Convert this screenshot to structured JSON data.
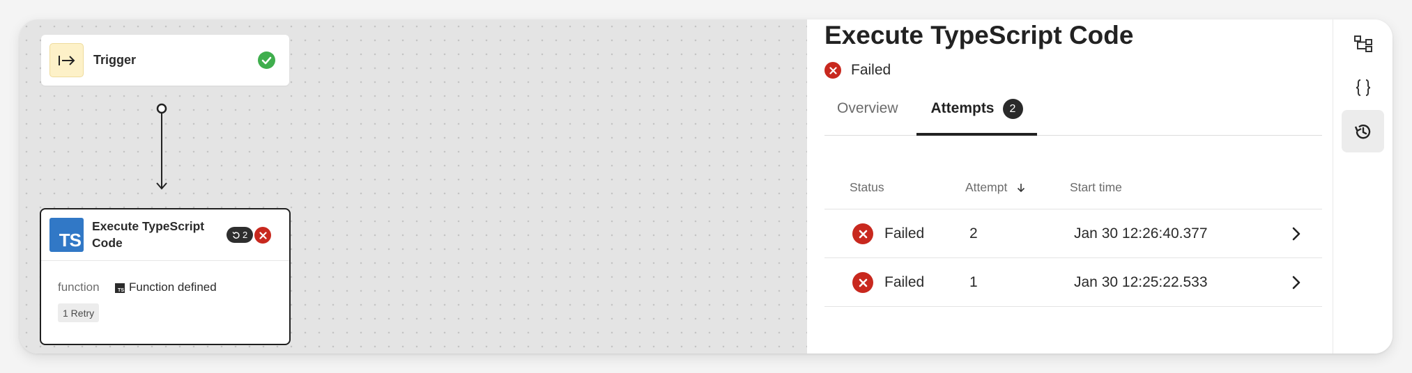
{
  "canvas": {
    "trigger_node": {
      "title": "Trigger",
      "status": "success"
    },
    "ts_node": {
      "title": "Execute TypeScript Code",
      "retry_count": "2",
      "status": "failed",
      "property_label": "function",
      "property_value": "Function defined",
      "retry_tag": "1 Retry",
      "logo_text": "TS",
      "fn_icon_text": "TS"
    }
  },
  "panel": {
    "title": "Execute TypeScript Code",
    "status_label": "Failed",
    "tabs": [
      {
        "label": "Overview",
        "active": false
      },
      {
        "label": "Attempts",
        "active": true,
        "count": "2"
      }
    ],
    "table": {
      "headers": {
        "status": "Status",
        "attempt": "Attempt",
        "start_time": "Start time"
      },
      "sort": {
        "column": "attempt",
        "direction": "descending"
      },
      "rows": [
        {
          "status": "Failed",
          "attempt": "2",
          "start_time": "Jan 30 12:26:40.377"
        },
        {
          "status": "Failed",
          "attempt": "1",
          "start_time": "Jan 30 12:25:22.533"
        }
      ]
    }
  },
  "rail": {
    "items": [
      {
        "icon": "workflow-tree-icon",
        "active": false
      },
      {
        "icon": "code-braces-icon",
        "active": false
      },
      {
        "icon": "history-icon",
        "active": true
      }
    ]
  },
  "colors": {
    "canvas_bg": "#e4e4e4",
    "success": "#3fae4d",
    "failed": "#c8281e",
    "typescript": "#3178c6",
    "trigger_bg": "#fdf1c8"
  }
}
